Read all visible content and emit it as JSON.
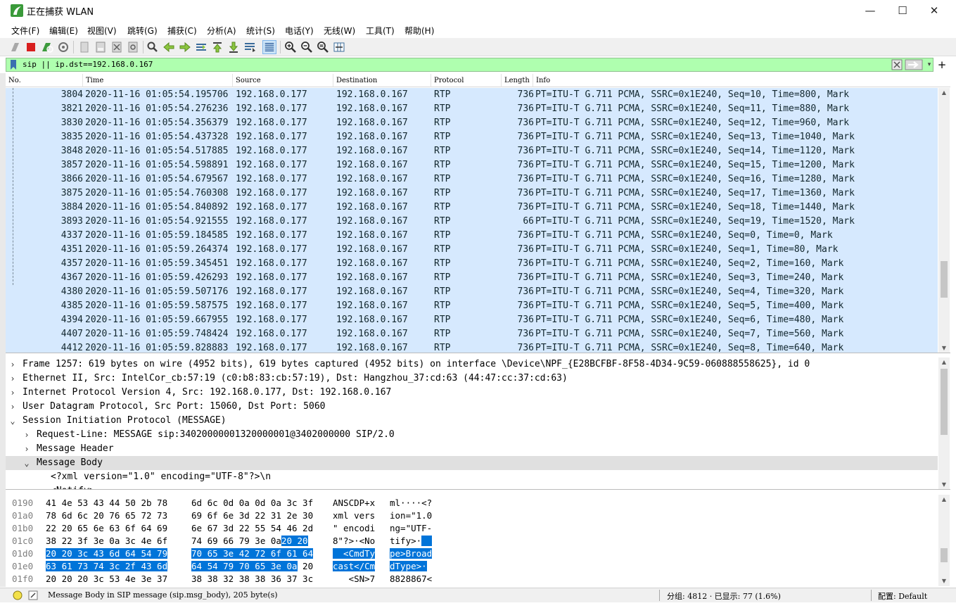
{
  "window": {
    "title": "正在捕获 WLAN",
    "minimize": "—",
    "maximize": "☐",
    "close": "✕"
  },
  "menu": [
    "文件(F)",
    "编辑(E)",
    "视图(V)",
    "跳转(G)",
    "捕获(C)",
    "分析(A)",
    "统计(S)",
    "电话(Y)",
    "无线(W)",
    "工具(T)",
    "帮助(H)"
  ],
  "toolbar_icons": [
    "start-capture-icon",
    "stop-capture-icon",
    "restart-capture-icon",
    "capture-options-icon",
    "open-file-icon",
    "save-file-icon",
    "close-file-icon",
    "reload-file-icon",
    "find-packet-icon",
    "go-back-icon",
    "go-forward-icon",
    "go-to-packet-icon",
    "go-first-icon",
    "go-last-icon",
    "autoscroll-icon",
    "colorize-icon",
    "zoom-in-icon",
    "zoom-out-icon",
    "zoom-normal-icon",
    "resize-columns-icon"
  ],
  "filter": {
    "value": "sip || ip.dst==192.168.0.167",
    "background": "#afffaf",
    "add_label": "+"
  },
  "packet_list": {
    "columns": [
      "No.",
      "Time",
      "Source",
      "Destination",
      "Protocol",
      "Length",
      "Info"
    ],
    "rows": [
      [
        "3804",
        "2020-11-16 01:05:54.195706",
        "192.168.0.177",
        "192.168.0.167",
        "RTP",
        "736",
        "PT=ITU-T G.711 PCMA, SSRC=0x1E240, Seq=10, Time=800, Mark"
      ],
      [
        "3821",
        "2020-11-16 01:05:54.276236",
        "192.168.0.177",
        "192.168.0.167",
        "RTP",
        "736",
        "PT=ITU-T G.711 PCMA, SSRC=0x1E240, Seq=11, Time=880, Mark"
      ],
      [
        "3830",
        "2020-11-16 01:05:54.356379",
        "192.168.0.177",
        "192.168.0.167",
        "RTP",
        "736",
        "PT=ITU-T G.711 PCMA, SSRC=0x1E240, Seq=12, Time=960, Mark"
      ],
      [
        "3835",
        "2020-11-16 01:05:54.437328",
        "192.168.0.177",
        "192.168.0.167",
        "RTP",
        "736",
        "PT=ITU-T G.711 PCMA, SSRC=0x1E240, Seq=13, Time=1040, Mark"
      ],
      [
        "3848",
        "2020-11-16 01:05:54.517885",
        "192.168.0.177",
        "192.168.0.167",
        "RTP",
        "736",
        "PT=ITU-T G.711 PCMA, SSRC=0x1E240, Seq=14, Time=1120, Mark"
      ],
      [
        "3857",
        "2020-11-16 01:05:54.598891",
        "192.168.0.177",
        "192.168.0.167",
        "RTP",
        "736",
        "PT=ITU-T G.711 PCMA, SSRC=0x1E240, Seq=15, Time=1200, Mark"
      ],
      [
        "3866",
        "2020-11-16 01:05:54.679567",
        "192.168.0.177",
        "192.168.0.167",
        "RTP",
        "736",
        "PT=ITU-T G.711 PCMA, SSRC=0x1E240, Seq=16, Time=1280, Mark"
      ],
      [
        "3875",
        "2020-11-16 01:05:54.760308",
        "192.168.0.177",
        "192.168.0.167",
        "RTP",
        "736",
        "PT=ITU-T G.711 PCMA, SSRC=0x1E240, Seq=17, Time=1360, Mark"
      ],
      [
        "3884",
        "2020-11-16 01:05:54.840892",
        "192.168.0.177",
        "192.168.0.167",
        "RTP",
        "736",
        "PT=ITU-T G.711 PCMA, SSRC=0x1E240, Seq=18, Time=1440, Mark"
      ],
      [
        "3893",
        "2020-11-16 01:05:54.921555",
        "192.168.0.177",
        "192.168.0.167",
        "RTP",
        "66",
        "PT=ITU-T G.711 PCMA, SSRC=0x1E240, Seq=19, Time=1520, Mark"
      ],
      [
        "4337",
        "2020-11-16 01:05:59.184585",
        "192.168.0.177",
        "192.168.0.167",
        "RTP",
        "736",
        "PT=ITU-T G.711 PCMA, SSRC=0x1E240, Seq=0, Time=0, Mark"
      ],
      [
        "4351",
        "2020-11-16 01:05:59.264374",
        "192.168.0.177",
        "192.168.0.167",
        "RTP",
        "736",
        "PT=ITU-T G.711 PCMA, SSRC=0x1E240, Seq=1, Time=80, Mark"
      ],
      [
        "4357",
        "2020-11-16 01:05:59.345451",
        "192.168.0.177",
        "192.168.0.167",
        "RTP",
        "736",
        "PT=ITU-T G.711 PCMA, SSRC=0x1E240, Seq=2, Time=160, Mark"
      ],
      [
        "4367",
        "2020-11-16 01:05:59.426293",
        "192.168.0.177",
        "192.168.0.167",
        "RTP",
        "736",
        "PT=ITU-T G.711 PCMA, SSRC=0x1E240, Seq=3, Time=240, Mark"
      ],
      [
        "4380",
        "2020-11-16 01:05:59.507176",
        "192.168.0.177",
        "192.168.0.167",
        "RTP",
        "736",
        "PT=ITU-T G.711 PCMA, SSRC=0x1E240, Seq=4, Time=320, Mark"
      ],
      [
        "4385",
        "2020-11-16 01:05:59.587575",
        "192.168.0.177",
        "192.168.0.167",
        "RTP",
        "736",
        "PT=ITU-T G.711 PCMA, SSRC=0x1E240, Seq=5, Time=400, Mark"
      ],
      [
        "4394",
        "2020-11-16 01:05:59.667955",
        "192.168.0.177",
        "192.168.0.167",
        "RTP",
        "736",
        "PT=ITU-T G.711 PCMA, SSRC=0x1E240, Seq=6, Time=480, Mark"
      ],
      [
        "4407",
        "2020-11-16 01:05:59.748424",
        "192.168.0.177",
        "192.168.0.167",
        "RTP",
        "736",
        "PT=ITU-T G.711 PCMA, SSRC=0x1E240, Seq=7, Time=560, Mark"
      ],
      [
        "4412",
        "2020-11-16 01:05:59.828883",
        "192.168.0.177",
        "192.168.0.167",
        "RTP",
        "736",
        "PT=ITU-T G.711 PCMA, SSRC=0x1E240, Seq=8, Time=640, Mark"
      ]
    ],
    "row_color": "#d6e9fe"
  },
  "details": [
    {
      "chevron": "›",
      "text": "Frame 1257: 619 bytes on wire (4952 bits), 619 bytes captured (4952 bits) on interface \\Device\\NPF_{E28BCFBF-8F58-4D34-9C59-060888558625}, id 0"
    },
    {
      "chevron": "›",
      "text": "Ethernet II, Src: IntelCor_cb:57:19 (c0:b8:83:cb:57:19), Dst: Hangzhou_37:cd:63 (44:47:cc:37:cd:63)"
    },
    {
      "chevron": "›",
      "text": "Internet Protocol Version 4, Src: 192.168.0.177, Dst: 192.168.0.167"
    },
    {
      "chevron": "›",
      "text": "User Datagram Protocol, Src Port: 15060, Dst Port: 5060"
    },
    {
      "chevron": "⌄",
      "text": "Session Initiation Protocol (MESSAGE)"
    },
    {
      "chevron": "›",
      "text": "Request-Line: MESSAGE sip:34020000001320000001@3402000000 SIP/2.0"
    },
    {
      "chevron": "›",
      "text": "Message Header"
    },
    {
      "chevron": "⌄",
      "text": "Message Body"
    },
    {
      "chevron": "",
      "text": "<?xml version=\"1.0\" encoding=\"UTF-8\"?>\\n"
    },
    {
      "chevron": "",
      "text": "<Notify>"
    }
  ],
  "hex_rows": [
    {
      "offset": "0190",
      "b1": "41 4e 53 43 44 50 2b 78",
      "b2": "6d 6c 0d 0a 0d 0a 3c 3f",
      "a1": "ANSCDP+x",
      "a2": "ml····<?"
    },
    {
      "offset": "01a0",
      "b1": "78 6d 6c 20 76 65 72 73",
      "b2": "69 6f 6e 3d 22 31 2e 30",
      "a1": "xml vers",
      "a2": "ion=\"1.0"
    },
    {
      "offset": "01b0",
      "b1": "22 20 65 6e 63 6f 64 69",
      "b2": "6e 67 3d 22 55 54 46 2d",
      "a1": "\" encodi",
      "a2": "ng=\"UTF-"
    },
    {
      "offset": "01c0",
      "b1": "38 22 3f 3e 0a 3c 4e 6f",
      "b2": "74 69 66 79 3e 0a",
      "b2h": "20 20",
      "a1": "8\"?>·<No",
      "a2": "tify>·",
      "a2h": "  "
    },
    {
      "offset": "01d0",
      "b1h": "20 20 3c 43 6d 64 54 79",
      "b2h": "70 65 3e 42 72 6f 61 64",
      "a1h": "  <CmdTy",
      "a2h": "pe>Broad"
    },
    {
      "offset": "01e0",
      "b1h": "63 61 73 74 3c 2f 43 6d",
      "b2h": "64 54 79 70 65 3e 0a",
      "b2t": " 20",
      "a1h": "cast</Cm",
      "a2h": "dType>·",
      "a2t": " "
    },
    {
      "offset": "01f0",
      "b1": "20 20 20 3c 53 4e 3e 37",
      "b2": "38 38 32 38 38 36 37 3c",
      "a1": "   <SN>7",
      "a2": "8828867<"
    }
  ],
  "status": {
    "message": "Message Body in SIP message (sip.msg_body), 205 byte(s)",
    "packets": "分组: 4812 · 已显示: 77 (1.6%)",
    "profile": "配置: Default"
  }
}
